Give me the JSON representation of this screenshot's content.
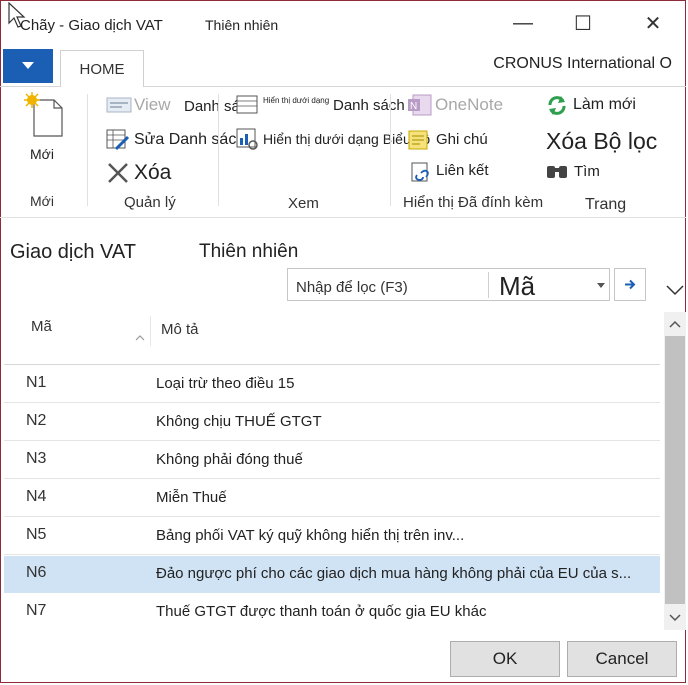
{
  "window": {
    "title": "Chãy - Giao dịch VAT",
    "subtitle": "Thiên nhiên",
    "minimize": "—",
    "maximize": "☐",
    "close": "✕"
  },
  "ribbon": {
    "tab_home": "HOME",
    "company": "CRONUS International O",
    "new_label": "Mới",
    "group_new": "Mới",
    "view_label": "View",
    "list_label": "Danh sách",
    "edit_list_label": "Sửa Danh sách",
    "delete_label": "Xóa",
    "group_manage": "Quản lý",
    "show_as_small": "Hiển thị dưới dạng",
    "list_label_2": "Danh sách",
    "show_as_chart": "Hiển thị dưới dạng Biểu đồ",
    "group_view": "Xem",
    "onenote_label": "OneNote",
    "notes_label": "Ghi chú",
    "links_label": "Liên kết",
    "group_attachments": "Hiển thị Đã đính kèm",
    "refresh_label": "Làm mới",
    "clear_filter_label": "Xóa Bộ lọc",
    "find_label": "Tìm",
    "group_page": "Trang"
  },
  "page": {
    "heading": "Giao dịch VAT",
    "subheading": "Thiên nhiên",
    "filter_placeholder": "Nhập để lọc (F3)",
    "filter_field": "Mã"
  },
  "table": {
    "col_code": "Mã",
    "col_desc": "Mô tả",
    "rows": [
      {
        "code": "N1",
        "desc": "Loại trừ theo điều 15"
      },
      {
        "code": "N2",
        "desc": "Không chịu THUẾ GTGT"
      },
      {
        "code": "N3",
        "desc": "Không phải  đóng thuế"
      },
      {
        "code": "N4",
        "desc": "Miễn Thuế"
      },
      {
        "code": "N5",
        "desc": "Bảng phối VAT ký quỹ không hiển thị trên inv..."
      },
      {
        "code": "N6",
        "desc": "Đảo ngược phí cho các giao dịch mua hàng không phải của EU của s..."
      },
      {
        "code": "N7",
        "desc": "Thuế GTGT được thanh toán ở quốc gia EU khác"
      }
    ],
    "selected_index": 5
  },
  "footer": {
    "ok_label": "OK",
    "cancel_label": "Cancel"
  },
  "colors": {
    "accent": "#1a5fb4",
    "selection": "#cfe3f5",
    "window_border": "#8f2a3a"
  }
}
